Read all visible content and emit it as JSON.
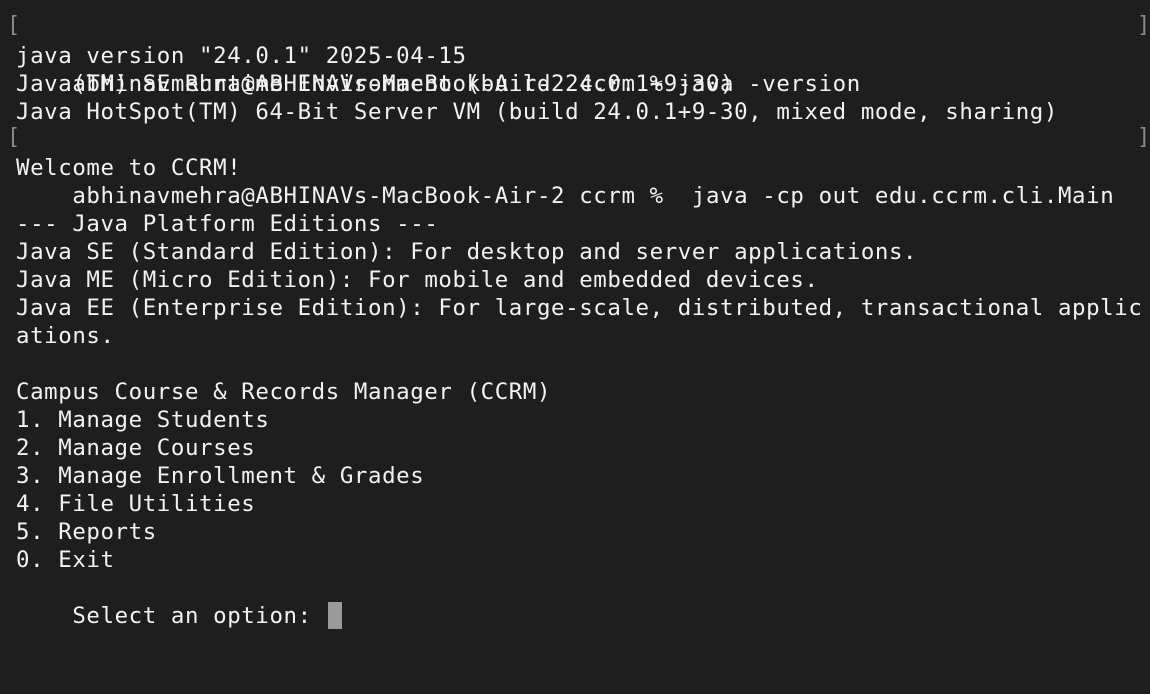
{
  "terminal": {
    "colors": {
      "background": "#1e1e1e",
      "foreground": "#f2f2f2",
      "bracket": "#8a8a8a",
      "cursor": "#9a9a9a"
    },
    "bracket_left_glyph": "[",
    "bracket_right_glyph": "]",
    "lines": [
      "abhinavmehra@ABHINAVs-MacBook-Air-2 ccrm % java -version",
      "java version \"24.0.1\" 2025-04-15",
      "Java(TM) SE Runtime Environment (build 24.0.1+9-30)",
      "Java HotSpot(TM) 64-Bit Server VM (build 24.0.1+9-30, mixed mode, sharing)",
      "abhinavmehra@ABHINAVs-MacBook-Air-2 ccrm %  java -cp out edu.ccrm.cli.Main",
      "Welcome to CCRM!",
      "",
      "--- Java Platform Editions ---",
      "Java SE (Standard Edition): For desktop and server applications.",
      "Java ME (Micro Edition): For mobile and embedded devices.",
      "Java EE (Enterprise Edition): For large-scale, distributed, transactional applic",
      "ations.",
      "",
      "Campus Course & Records Manager (CCRM)",
      "1. Manage Students",
      "2. Manage Courses",
      "3. Manage Enrollment & Grades",
      "4. File Utilities",
      "5. Reports",
      "0. Exit",
      "Select an option: "
    ]
  }
}
